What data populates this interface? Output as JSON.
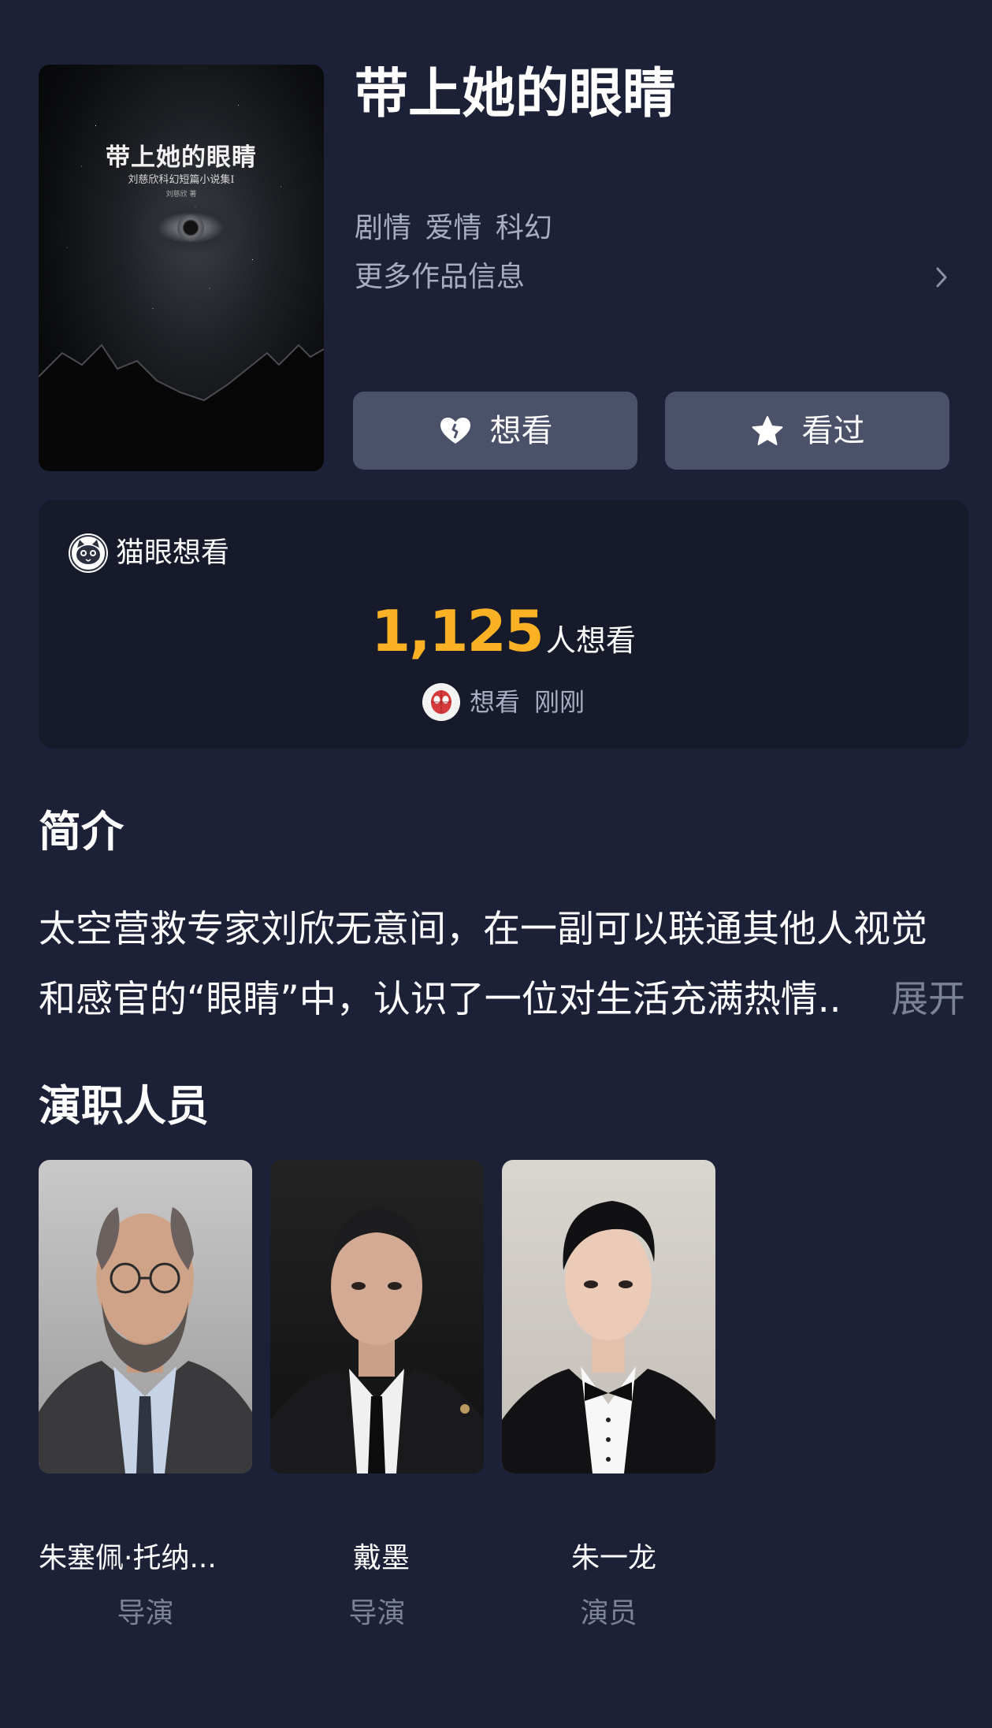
{
  "poster": {
    "title": "带上她的眼睛",
    "subtitle": "刘慈欣科幻短篇小说集Ⅰ",
    "author": "刘慈欣 著"
  },
  "movie": {
    "title": "带上她的眼睛",
    "genres": "剧情 爱情 科幻",
    "more_info_label": "更多作品信息"
  },
  "actions": {
    "want_label": "想看",
    "watched_label": "看过"
  },
  "maoyan": {
    "title": "猫眼想看",
    "want_count": "1,125",
    "want_suffix": "人想看",
    "recent_action": "想看",
    "recent_time": "刚刚",
    "accent_color": "#fbb124"
  },
  "synopsis": {
    "title": "简介",
    "line1": "太空营救专家刘欣无意间，在一副可以联通其他人视觉",
    "line2": "和感官的“眼睛”中，认识了一位对生活充满热情..",
    "expand_label": "展开"
  },
  "cast": {
    "title": "演职人员",
    "members": [
      {
        "name": "朱塞佩·托纳...",
        "role": "导演"
      },
      {
        "name": "戴墨",
        "role": "导演"
      },
      {
        "name": "朱一龙",
        "role": "演员"
      }
    ]
  },
  "icons": {
    "chevron": "chevron-right-icon",
    "heart": "heart-icon",
    "star": "star-icon",
    "maoyan_logo": "maoyan-cat-icon"
  }
}
